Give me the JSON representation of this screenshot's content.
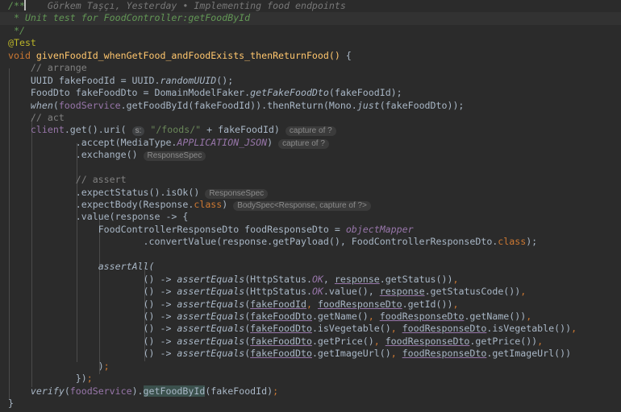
{
  "app": {
    "type": "code-editor",
    "language": "Java",
    "theme": "Darcula"
  },
  "colors": {
    "background": "#2b2b2b",
    "caret_line": "#323232",
    "default_text": "#a9b7c6",
    "comment": "#629755",
    "line_comment": "#808080",
    "keyword": "#cc7832",
    "annotation": "#bbb529",
    "string": "#6a8759",
    "field": "#9876aa",
    "indent_guide": "#4b4b4b",
    "inlay_hint_bg": "#3b3b3b",
    "inlay_hint_fg": "#8c8c8c",
    "identifier_highlight": "#3b514d",
    "caret": "#bbbbbb",
    "blame_text": "#787878"
  },
  "blame_annotation": {
    "author": "Görkem Taşçı",
    "date": "Yesterday",
    "separator": "•",
    "message": "Implementing food endpoints",
    "full": "Görkem Taşçı, Yesterday • Implementing food endpoints"
  },
  "code": {
    "javadoc_open": "/**",
    "javadoc_body": " * Unit test for FoodController:getFoodById",
    "javadoc_close": " */",
    "annotation_test": "@Test",
    "signature": {
      "modifier": "void",
      "name": "givenFoodId_whenGetFood_andFoodExists_thenReturnFood()",
      "brace": "{"
    },
    "comment_arrange": "// arrange",
    "comment_act": "// act",
    "comment_assert": "// assert",
    "line_uuid": "UUID fakeFoodId = UUID.randomUUID();",
    "line_fooddto": "FoodDto fakeFoodDto = DomainModelFaker.getFakeFoodDto(fakeFoodId);",
    "line_when": "when(foodService.getFoodById(fakeFoodId)).thenReturn(Mono.just(fakeFoodDto));",
    "line_client_get": "client.get().uri( \"/foods/\" + fakeFoodId)",
    "line_accept": ".accept(MediaType.APPLICATION_JSON)",
    "line_exchange": ".exchange()",
    "line_expect_status": ".expectStatus().isOk()",
    "line_expect_body": ".expectBody(Response.class)",
    "line_value": ".value(response -> {",
    "line_dto_decl": "FoodControllerResponseDto foodResponseDto = objectMapper",
    "line_convert": ".convertValue(response.getPayload(), FoodControllerResponseDto.class);",
    "line_assertall": "assertAll(",
    "assertions": [
      "() -> assertEquals(HttpStatus.OK, response.getStatus()),",
      "() -> assertEquals(HttpStatus.OK.value(), response.getStatusCode()),",
      "() -> assertEquals(fakeFoodId, foodResponseDto.getId()),",
      "() -> assertEquals(fakeFoodDto.getName(), foodResponseDto.getName()),",
      "() -> assertEquals(fakeFoodDto.isVegetable(), foodResponseDto.isVegetable()),",
      "() -> assertEquals(fakeFoodDto.getPrice(), foodResponseDto.getPrice()),",
      "() -> assertEquals(fakeFoodDto.getImageUrl(), foodResponseDto.getImageUrl())"
    ],
    "line_close_assertall": ");",
    "line_close_lambda": "});",
    "line_verify": "verify(foodService).getFoodById(fakeFoodId);",
    "line_close_method": "}"
  },
  "inlay_hints": {
    "param_s": "s:",
    "capture_of_1": "capture of ?",
    "capture_of_2": "capture of ?",
    "response_spec_1": "ResponseSpec",
    "response_spec_2": "ResponseSpec",
    "body_spec": "BodySpec<Response, capture of ?>"
  },
  "tokens": {
    "kw_void": "void",
    "kw_class": "class",
    "highlighted_identifier": "getFoodById"
  }
}
